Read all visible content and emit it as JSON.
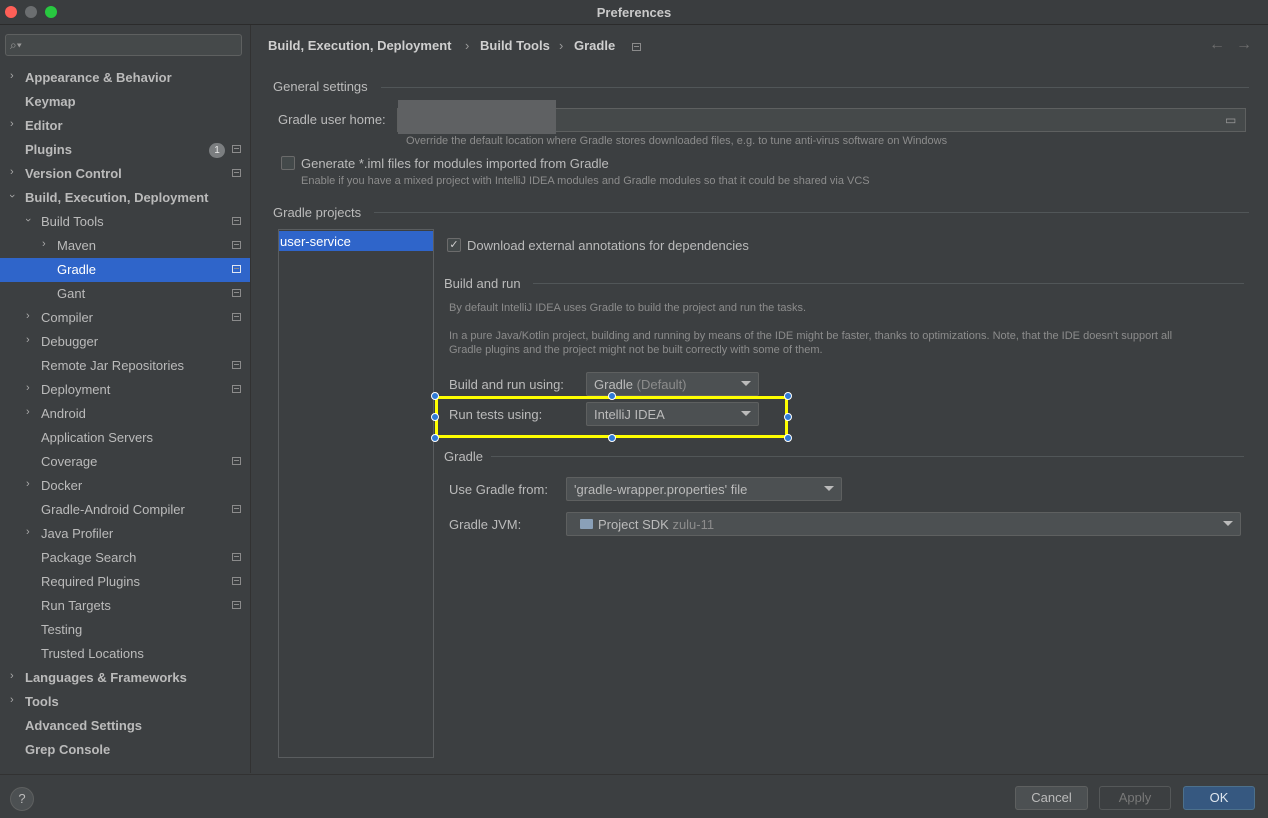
{
  "window": {
    "title": "Preferences"
  },
  "sidebar": {
    "search_placeholder": "",
    "items": [
      {
        "label": "Appearance & Behavior"
      },
      {
        "label": "Keymap"
      },
      {
        "label": "Editor"
      },
      {
        "label": "Plugins",
        "badge": "1"
      },
      {
        "label": "Version Control"
      },
      {
        "label": "Build, Execution, Deployment"
      },
      {
        "label": "Build Tools"
      },
      {
        "label": "Maven"
      },
      {
        "label": "Gradle"
      },
      {
        "label": "Gant"
      },
      {
        "label": "Compiler"
      },
      {
        "label": "Debugger"
      },
      {
        "label": "Remote Jar Repositories"
      },
      {
        "label": "Deployment"
      },
      {
        "label": "Android"
      },
      {
        "label": "Application Servers"
      },
      {
        "label": "Coverage"
      },
      {
        "label": "Docker"
      },
      {
        "label": "Gradle-Android Compiler"
      },
      {
        "label": "Java Profiler"
      },
      {
        "label": "Package Search"
      },
      {
        "label": "Required Plugins"
      },
      {
        "label": "Run Targets"
      },
      {
        "label": "Testing"
      },
      {
        "label": "Trusted Locations"
      },
      {
        "label": "Languages & Frameworks"
      },
      {
        "label": "Tools"
      },
      {
        "label": "Advanced Settings"
      },
      {
        "label": "Grep Console"
      }
    ]
  },
  "breadcrumb": [
    "Build, Execution, Deployment",
    "Build Tools",
    "Gradle"
  ],
  "general": {
    "title": "General settings",
    "user_home_label": "Gradle user home:",
    "user_home_value": "",
    "user_home_hint": "Override the default location where Gradle stores downloaded files, e.g. to tune anti-virus software on Windows",
    "iml_label": "Generate *.iml files for modules imported from Gradle",
    "iml_hint": "Enable if you have a mixed project with IntelliJ IDEA modules and Gradle modules so that it could be shared via VCS",
    "iml_checked": false
  },
  "projects": {
    "title": "Gradle projects",
    "list": [
      "user-service"
    ],
    "annotations_label": "Download external annotations for dependencies",
    "annotations_checked": true
  },
  "build_run": {
    "title": "Build and run",
    "hint1": "By default IntelliJ IDEA uses Gradle to build the project and run the tasks.",
    "hint2a": "In a pure Java/Kotlin project, building and running by means of the IDE might be faster, thanks to optimizations. Note, that the IDE doesn't support all",
    "hint2b": "Gradle plugins and the project might not be built correctly with some of them.",
    "build_label": "Build and run using:",
    "build_value": "Gradle",
    "build_value_suffix": "(Default)",
    "tests_label": "Run tests using:",
    "tests_value": "IntelliJ IDEA"
  },
  "gradle": {
    "title": "Gradle",
    "from_label": "Use Gradle from:",
    "from_value": "'gradle-wrapper.properties' file",
    "jvm_label": "Gradle JVM:",
    "jvm_value": "Project SDK",
    "jvm_suffix": "zulu-11"
  },
  "footer": {
    "help": "?",
    "cancel": "Cancel",
    "apply": "Apply",
    "ok": "OK"
  },
  "colors": {
    "selection": "#2f65ca",
    "highlight": "#ffff00",
    "ok_button": "#365880"
  }
}
